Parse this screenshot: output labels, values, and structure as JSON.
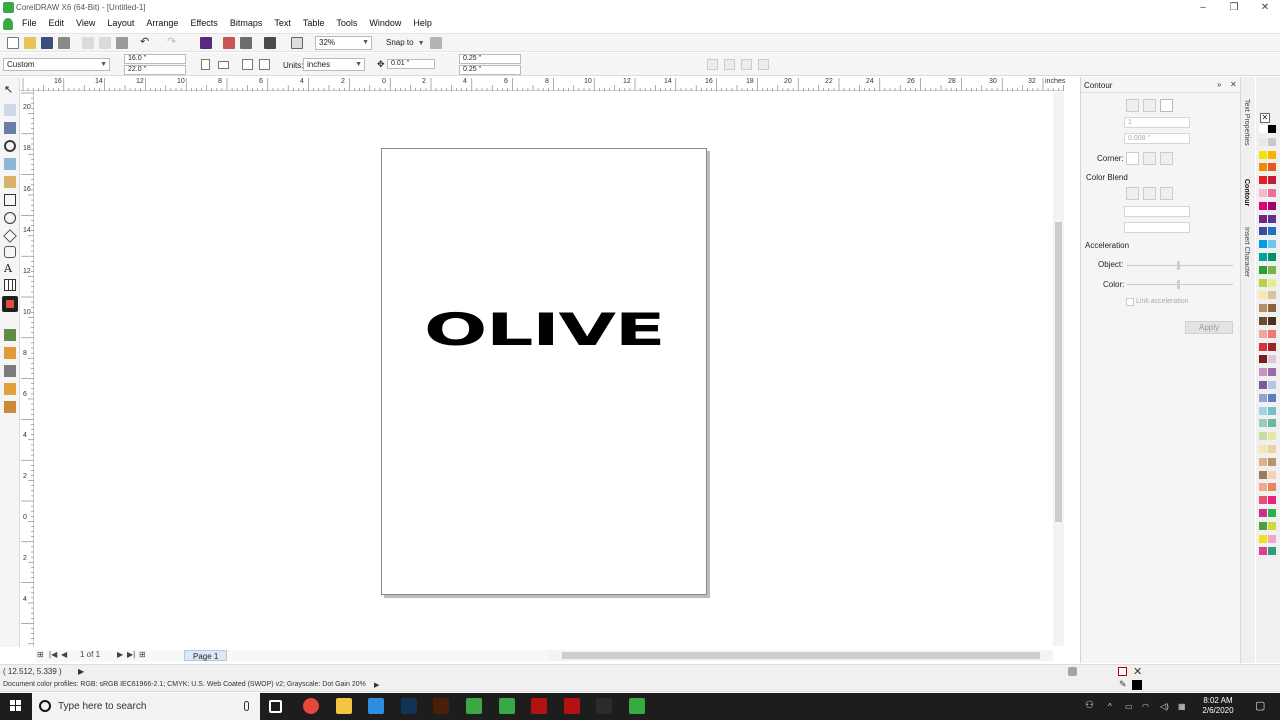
{
  "window": {
    "title": "CorelDRAW X6 (64-Bit) - [Untitled-1]"
  },
  "menu": [
    "File",
    "Edit",
    "View",
    "Layout",
    "Arrange",
    "Effects",
    "Bitmaps",
    "Text",
    "Table",
    "Tools",
    "Window",
    "Help"
  ],
  "toolbar": {
    "zoom": "32%",
    "snap_to": "Snap to"
  },
  "property_bar": {
    "page_size": "Custom",
    "width": "16.0 \"",
    "height": "22.0 \"",
    "units_label": "Units:",
    "units": "inches",
    "nudge": "0.01 \"",
    "dup_x": "0.25 \"",
    "dup_y": "0.25 \""
  },
  "ruler": {
    "units": "inches",
    "h_labels": [
      "16",
      "14",
      "12",
      "10",
      "8",
      "6",
      "4",
      "2",
      "0",
      "2",
      "4",
      "6",
      "8",
      "10",
      "12",
      "14",
      "16",
      "18",
      "20",
      "22",
      "24",
      "26",
      "28",
      "30",
      "32"
    ],
    "v_labels": [
      "20",
      "18",
      "16",
      "14",
      "12",
      "10",
      "8",
      "6",
      "4",
      "2",
      "0",
      "2",
      "4"
    ]
  },
  "artwork": {
    "text": "OLIVE"
  },
  "page_nav": {
    "count": "1 of 1",
    "tab": "Page 1"
  },
  "status": {
    "coords": "( 12.512, 5.339 )",
    "color_profiles": "Document color profiles: RGB: sRGB IEC61966-2.1; CMYK: U.S. Web Coated (SWOP) v2; Grayscale: Dot Gain 20%"
  },
  "docker": {
    "title": "Contour",
    "steps": "1",
    "offset": "0.008 \"",
    "corner_label": "Corner:",
    "color_blend_label": "Color Blend",
    "acceleration_label": "Acceleration",
    "object_label": "Object:",
    "color_label": "Color:",
    "link_label": "Link acceleration",
    "apply_label": "Apply"
  },
  "docker_tabs": [
    "Text Properties",
    "Contour",
    "Insert Character"
  ],
  "palette": [
    "#ffffff",
    "#000000",
    "#e8e8e8",
    "#c8c8c8",
    "#f6e400",
    "#f7b400",
    "#f08a00",
    "#e8571c",
    "#e41e25",
    "#c41a38",
    "#f5b8c6",
    "#ec6c9a",
    "#e2007a",
    "#a2006b",
    "#70267f",
    "#5b3491",
    "#3b4da1",
    "#1e73be",
    "#009ee0",
    "#6fc7ee",
    "#00a29a",
    "#00935f",
    "#2e9d3a",
    "#7ab342",
    "#b9d14b",
    "#e5ec96",
    "#f7e8a8",
    "#d9c39a",
    "#b48f68",
    "#8a6440",
    "#6f4a2c",
    "#4a3020",
    "#f5a3a0",
    "#ee7778",
    "#d1363f",
    "#a0222a",
    "#7a1b22",
    "#e0c4d8",
    "#c696c0",
    "#9c6aa8",
    "#7a5b96",
    "#b7c4e3",
    "#8ea4d2",
    "#5e7fbe",
    "#9fd4e4",
    "#72bfcf",
    "#95cfb9",
    "#66b99a",
    "#c7dca1",
    "#e1e9a8",
    "#f1e7b6",
    "#ead3a1",
    "#d8b582",
    "#b9936a",
    "#9d7a5a",
    "#f8cfb3",
    "#f0a886",
    "#e68361",
    "#ef4e6d",
    "#e8237d",
    "#cc2f8c",
    "#29b24a",
    "#4d9e3f",
    "#d3d93b",
    "#efe21f",
    "#f4a7c4",
    "#e63c8f",
    "#2a9c78"
  ],
  "taskbar": {
    "search_placeholder": "Type here to search",
    "time": "8:02 AM",
    "date": "2/6/2020",
    "apps": [
      {
        "name": "chrome",
        "color": "#e5473b"
      },
      {
        "name": "file-explorer",
        "color": "#f4c542"
      },
      {
        "name": "store",
        "color": "#2f8de0"
      },
      {
        "name": "photoshop",
        "color": "#0f3454"
      },
      {
        "name": "illustrator",
        "color": "#4a1f0a"
      },
      {
        "name": "coreldraw",
        "color": "#3aa845"
      },
      {
        "name": "coreldraw-2",
        "color": "#3aa845"
      },
      {
        "name": "acrobat",
        "color": "#b31212"
      },
      {
        "name": "acrobat-2",
        "color": "#b31212"
      },
      {
        "name": "app-dark",
        "color": "#2b2b2b"
      },
      {
        "name": "coreldraw-3",
        "color": "#3aa845"
      }
    ]
  }
}
